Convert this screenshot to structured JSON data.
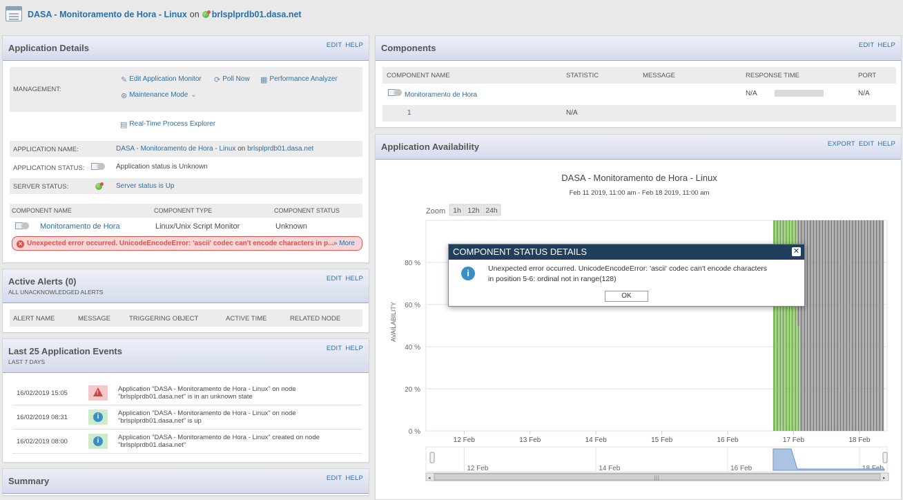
{
  "header": {
    "app_name": "DASA - Monitoramento de Hora - Linux",
    "on": "on",
    "node": "brlsplprdb01.dasa.net"
  },
  "app_details": {
    "title": "Application Details",
    "edit": "EDIT",
    "help": "HELP",
    "management_label": "MANAGEMENT:",
    "actions": {
      "edit_monitor": "Edit Application Monitor",
      "poll_now": "Poll Now",
      "perf_analyzer": "Performance Analyzer",
      "maintenance_mode": "Maintenance Mode",
      "rt_process_explorer": "Real-Time Process Explorer"
    },
    "app_name_label": "APPLICATION NAME:",
    "app_name_value": "DASA - Monitoramento de Hora - Linux",
    "app_name_on": "on",
    "app_name_node": "brlsplprdb01.dasa.net",
    "app_status_label": "APPLICATION STATUS:",
    "app_status_value": "Application status is Unknown",
    "server_status_label": "SERVER STATUS:",
    "server_status_value": "Server status is Up",
    "comp_headers": [
      "COMPONENT NAME",
      "COMPONENT TYPE",
      "COMPONENT STATUS"
    ],
    "comp_row": {
      "name": "Monitoramento de Hora",
      "type": "Linux/Unix Script Monitor",
      "status": "Unknown"
    },
    "error_text": "Unexpected error occurred. UnicodeEncodeError: 'ascii' codec can't encode characters in p...",
    "error_more": "» More"
  },
  "active_alerts": {
    "title": "Active Alerts (0)",
    "subtitle": "ALL UNACKNOWLEDGED ALERTS",
    "edit": "EDIT",
    "help": "HELP",
    "headers": [
      "ALERT NAME",
      "MESSAGE",
      "TRIGGERING OBJECT",
      "ACTIVE TIME",
      "RELATED NODE"
    ]
  },
  "events": {
    "title": "Last 25 Application Events",
    "subtitle": "LAST 7 DAYS",
    "edit": "EDIT",
    "help": "HELP",
    "rows": [
      {
        "date": "16/02/2019 15:05",
        "line1": "Application \"DASA - Monitoramento de Hora - Linux\" on node",
        "line2": "\"brlsplprdb01.dasa.net\" is in an unknown state"
      },
      {
        "date": "16/02/2019 08:31",
        "line1": "Application \"DASA - Monitoramento de Hora - Linux\" on node",
        "line2": "\"brlsplprdb01.dasa.net\" is up"
      },
      {
        "date": "16/02/2019 08:00",
        "line1": "Application \"DASA - Monitoramento de Hora - Linux\" created on node",
        "line2": "\"brlsplprdb01.dasa.net\""
      }
    ]
  },
  "summary": {
    "title": "Summary",
    "edit": "EDIT",
    "help": "HELP"
  },
  "components": {
    "title": "Components",
    "edit": "EDIT",
    "help": "HELP",
    "headers": [
      "COMPONENT NAME",
      "STATISTIC",
      "MESSAGE",
      "RESPONSE TIME",
      "PORT"
    ],
    "row": {
      "name": "Monitoramento de Hora",
      "response": "N/A",
      "port": "N/A"
    },
    "subrow": {
      "name": "1",
      "statistic": "N/A"
    }
  },
  "availability": {
    "title": "Application Availability",
    "export": "EXPORT",
    "edit": "EDIT",
    "help": "HELP"
  },
  "chart_data": {
    "type": "bar",
    "title": "DASA - Monitoramento de Hora - Linux",
    "subtitle": "Feb 11 2019, 11:00 am - Feb 18 2019, 11:00 am",
    "ylabel": "AVAILABILITY",
    "ylim": [
      0,
      100
    ],
    "yticks": [
      "0 %",
      "20 %",
      "40 %",
      "60 %",
      "80 %"
    ],
    "xticks": [
      "12 Feb",
      "13 Feb",
      "14 Feb",
      "15 Feb",
      "16 Feb",
      "17 Feb",
      "18 Feb"
    ],
    "navigator_ticks": [
      "12 Feb",
      "14 Feb",
      "16 Feb",
      "18 Feb"
    ],
    "zoom_label": "Zoom",
    "zoom_options": [
      "1h",
      "12h",
      "24h"
    ],
    "series": [
      {
        "color": "#7fba58",
        "values": [
          100,
          100,
          100,
          100,
          100,
          100,
          100,
          100,
          50,
          0,
          0,
          0,
          0,
          0,
          0,
          0,
          0,
          0,
          0,
          0,
          0,
          0,
          0,
          0,
          0,
          0,
          0,
          0,
          0,
          0,
          0,
          0,
          0,
          0,
          0,
          0,
          0
        ]
      },
      {
        "color": "#8c8c8c",
        "values": [
          0,
          0,
          0,
          0,
          0,
          0,
          0,
          0,
          50,
          100,
          100,
          100,
          100,
          100,
          100,
          100,
          100,
          100,
          100,
          100,
          100,
          100,
          100,
          100,
          100,
          100,
          100,
          100,
          100,
          100,
          100,
          100,
          100,
          100,
          100,
          100,
          100
        ]
      }
    ]
  },
  "modal": {
    "title": "COMPONENT STATUS DETAILS",
    "line1": "Unexpected error occurred. UnicodeEncodeError: 'ascii' codec can't encode characters",
    "line2": "in position 5-6: ordinal not in range(128)",
    "ok": "OK"
  }
}
